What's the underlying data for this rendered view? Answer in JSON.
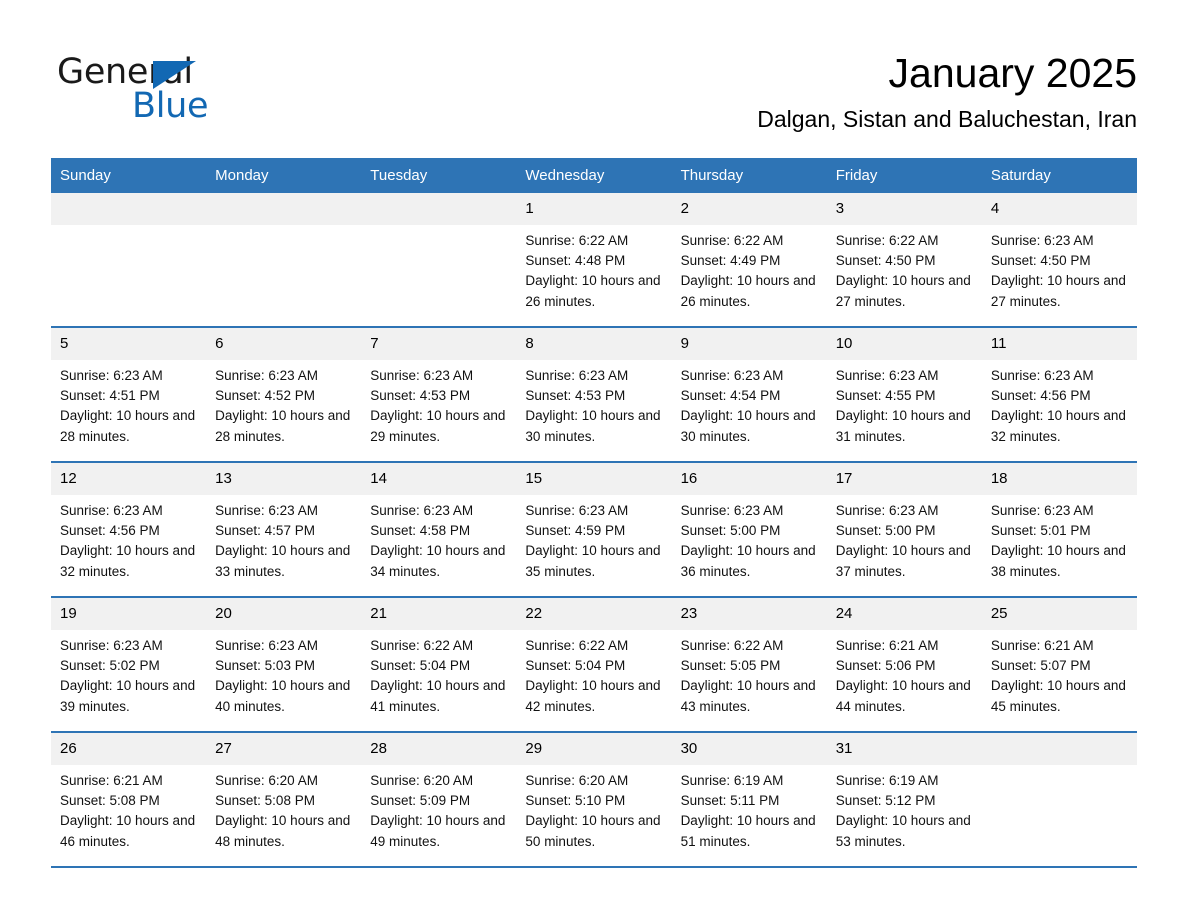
{
  "brand": {
    "name_part1": "General",
    "name_part2": "Blue",
    "triangle_icon": "triangle-icon",
    "accent_color": "#1268b3"
  },
  "header": {
    "title": "January 2025",
    "subtitle": "Dalgan, Sistan and Baluchestan, Iran"
  },
  "theme": {
    "header_blue": "#2e74b5",
    "daynum_band": "#f1f1f1",
    "page_background": "#ffffff"
  },
  "calendar": {
    "weekday_headers": [
      "Sunday",
      "Monday",
      "Tuesday",
      "Wednesday",
      "Thursday",
      "Friday",
      "Saturday"
    ],
    "weeks": [
      [
        {
          "day": "",
          "empty": true
        },
        {
          "day": "",
          "empty": true
        },
        {
          "day": "",
          "empty": true
        },
        {
          "day": "1",
          "sunrise": "Sunrise: 6:22 AM",
          "sunset": "Sunset: 4:48 PM",
          "daylight": "Daylight: 10 hours and 26 minutes."
        },
        {
          "day": "2",
          "sunrise": "Sunrise: 6:22 AM",
          "sunset": "Sunset: 4:49 PM",
          "daylight": "Daylight: 10 hours and 26 minutes."
        },
        {
          "day": "3",
          "sunrise": "Sunrise: 6:22 AM",
          "sunset": "Sunset: 4:50 PM",
          "daylight": "Daylight: 10 hours and 27 minutes."
        },
        {
          "day": "4",
          "sunrise": "Sunrise: 6:23 AM",
          "sunset": "Sunset: 4:50 PM",
          "daylight": "Daylight: 10 hours and 27 minutes."
        }
      ],
      [
        {
          "day": "5",
          "sunrise": "Sunrise: 6:23 AM",
          "sunset": "Sunset: 4:51 PM",
          "daylight": "Daylight: 10 hours and 28 minutes."
        },
        {
          "day": "6",
          "sunrise": "Sunrise: 6:23 AM",
          "sunset": "Sunset: 4:52 PM",
          "daylight": "Daylight: 10 hours and 28 minutes."
        },
        {
          "day": "7",
          "sunrise": "Sunrise: 6:23 AM",
          "sunset": "Sunset: 4:53 PM",
          "daylight": "Daylight: 10 hours and 29 minutes."
        },
        {
          "day": "8",
          "sunrise": "Sunrise: 6:23 AM",
          "sunset": "Sunset: 4:53 PM",
          "daylight": "Daylight: 10 hours and 30 minutes."
        },
        {
          "day": "9",
          "sunrise": "Sunrise: 6:23 AM",
          "sunset": "Sunset: 4:54 PM",
          "daylight": "Daylight: 10 hours and 30 minutes."
        },
        {
          "day": "10",
          "sunrise": "Sunrise: 6:23 AM",
          "sunset": "Sunset: 4:55 PM",
          "daylight": "Daylight: 10 hours and 31 minutes."
        },
        {
          "day": "11",
          "sunrise": "Sunrise: 6:23 AM",
          "sunset": "Sunset: 4:56 PM",
          "daylight": "Daylight: 10 hours and 32 minutes."
        }
      ],
      [
        {
          "day": "12",
          "sunrise": "Sunrise: 6:23 AM",
          "sunset": "Sunset: 4:56 PM",
          "daylight": "Daylight: 10 hours and 32 minutes."
        },
        {
          "day": "13",
          "sunrise": "Sunrise: 6:23 AM",
          "sunset": "Sunset: 4:57 PM",
          "daylight": "Daylight: 10 hours and 33 minutes."
        },
        {
          "day": "14",
          "sunrise": "Sunrise: 6:23 AM",
          "sunset": "Sunset: 4:58 PM",
          "daylight": "Daylight: 10 hours and 34 minutes."
        },
        {
          "day": "15",
          "sunrise": "Sunrise: 6:23 AM",
          "sunset": "Sunset: 4:59 PM",
          "daylight": "Daylight: 10 hours and 35 minutes."
        },
        {
          "day": "16",
          "sunrise": "Sunrise: 6:23 AM",
          "sunset": "Sunset: 5:00 PM",
          "daylight": "Daylight: 10 hours and 36 minutes."
        },
        {
          "day": "17",
          "sunrise": "Sunrise: 6:23 AM",
          "sunset": "Sunset: 5:00 PM",
          "daylight": "Daylight: 10 hours and 37 minutes."
        },
        {
          "day": "18",
          "sunrise": "Sunrise: 6:23 AM",
          "sunset": "Sunset: 5:01 PM",
          "daylight": "Daylight: 10 hours and 38 minutes."
        }
      ],
      [
        {
          "day": "19",
          "sunrise": "Sunrise: 6:23 AM",
          "sunset": "Sunset: 5:02 PM",
          "daylight": "Daylight: 10 hours and 39 minutes."
        },
        {
          "day": "20",
          "sunrise": "Sunrise: 6:23 AM",
          "sunset": "Sunset: 5:03 PM",
          "daylight": "Daylight: 10 hours and 40 minutes."
        },
        {
          "day": "21",
          "sunrise": "Sunrise: 6:22 AM",
          "sunset": "Sunset: 5:04 PM",
          "daylight": "Daylight: 10 hours and 41 minutes."
        },
        {
          "day": "22",
          "sunrise": "Sunrise: 6:22 AM",
          "sunset": "Sunset: 5:04 PM",
          "daylight": "Daylight: 10 hours and 42 minutes."
        },
        {
          "day": "23",
          "sunrise": "Sunrise: 6:22 AM",
          "sunset": "Sunset: 5:05 PM",
          "daylight": "Daylight: 10 hours and 43 minutes."
        },
        {
          "day": "24",
          "sunrise": "Sunrise: 6:21 AM",
          "sunset": "Sunset: 5:06 PM",
          "daylight": "Daylight: 10 hours and 44 minutes."
        },
        {
          "day": "25",
          "sunrise": "Sunrise: 6:21 AM",
          "sunset": "Sunset: 5:07 PM",
          "daylight": "Daylight: 10 hours and 45 minutes."
        }
      ],
      [
        {
          "day": "26",
          "sunrise": "Sunrise: 6:21 AM",
          "sunset": "Sunset: 5:08 PM",
          "daylight": "Daylight: 10 hours and 46 minutes."
        },
        {
          "day": "27",
          "sunrise": "Sunrise: 6:20 AM",
          "sunset": "Sunset: 5:08 PM",
          "daylight": "Daylight: 10 hours and 48 minutes."
        },
        {
          "day": "28",
          "sunrise": "Sunrise: 6:20 AM",
          "sunset": "Sunset: 5:09 PM",
          "daylight": "Daylight: 10 hours and 49 minutes."
        },
        {
          "day": "29",
          "sunrise": "Sunrise: 6:20 AM",
          "sunset": "Sunset: 5:10 PM",
          "daylight": "Daylight: 10 hours and 50 minutes."
        },
        {
          "day": "30",
          "sunrise": "Sunrise: 6:19 AM",
          "sunset": "Sunset: 5:11 PM",
          "daylight": "Daylight: 10 hours and 51 minutes."
        },
        {
          "day": "31",
          "sunrise": "Sunrise: 6:19 AM",
          "sunset": "Sunset: 5:12 PM",
          "daylight": "Daylight: 10 hours and 53 minutes."
        },
        {
          "day": "",
          "empty": true
        }
      ]
    ]
  }
}
